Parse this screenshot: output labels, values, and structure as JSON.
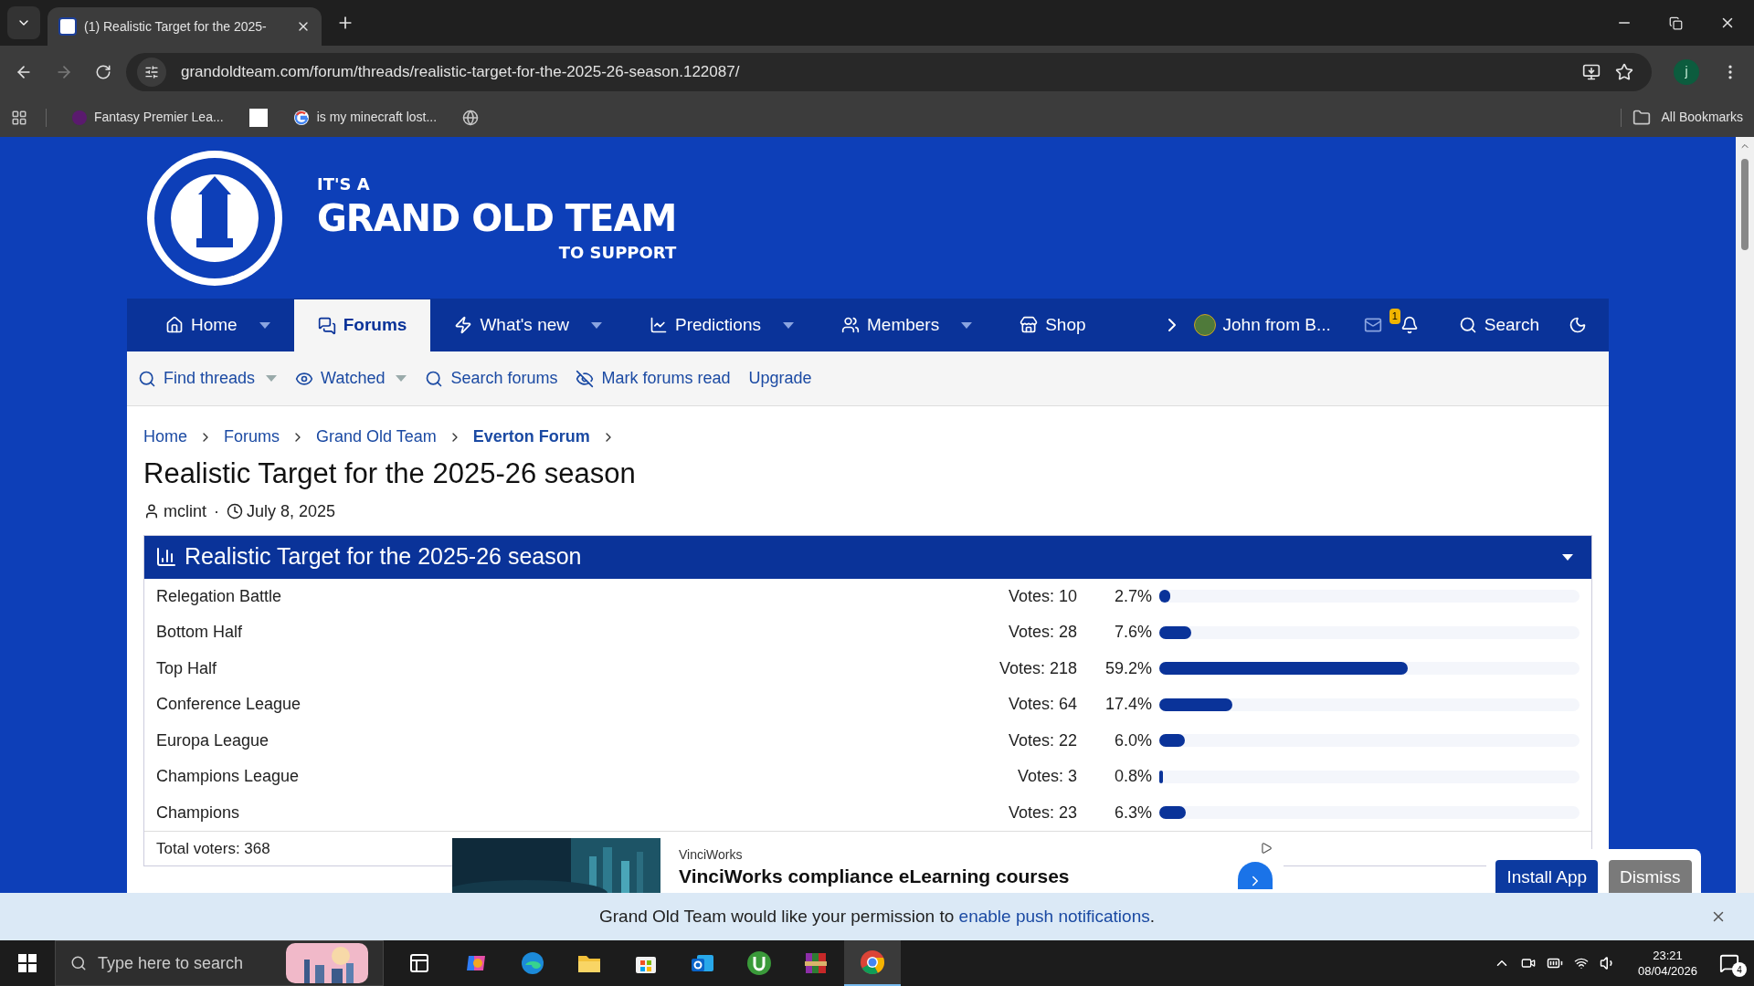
{
  "browser": {
    "tabs": [
      {
        "title": "(1) Realistic Target for the 2025-",
        "selected": true
      }
    ],
    "url": "grandoldteam.com/forum/threads/realistic-target-for-the-2025-26-season.122087/",
    "bookmarks": [
      {
        "kind": "league",
        "label": "Fantasy Premier Lea..."
      },
      {
        "kind": "blank"
      },
      {
        "kind": "google",
        "label": "is my minecraft lost..."
      },
      {
        "kind": "globe"
      }
    ],
    "all_bookmarks": "All Bookmarks",
    "profile_initial": "j"
  },
  "header": {
    "logo_lines": [
      "IT'S A",
      "GRAND OLD TEAM",
      "TO SUPPORT"
    ]
  },
  "nav": {
    "items": [
      {
        "kind": "home",
        "label": "Home",
        "dropdown": true,
        "selected": false
      },
      {
        "kind": "forums",
        "label": "Forums",
        "dropdown": false,
        "selected": true
      },
      {
        "kind": "new",
        "label": "What's new",
        "dropdown": true,
        "selected": false
      },
      {
        "kind": "predictions",
        "label": "Predictions",
        "dropdown": true,
        "selected": false
      },
      {
        "kind": "members",
        "label": "Members",
        "dropdown": true,
        "selected": false
      },
      {
        "kind": "shop",
        "label": "Shop",
        "dropdown": false,
        "selected": false
      }
    ],
    "user": "John from B...",
    "alert_count": "1",
    "search": "Search"
  },
  "subnav": [
    {
      "kind": "find",
      "label": "Find threads",
      "dropdown": true
    },
    {
      "kind": "watched",
      "label": "Watched",
      "dropdown": true
    },
    {
      "kind": "search",
      "label": "Search forums",
      "dropdown": false
    },
    {
      "kind": "mark",
      "label": "Mark forums read",
      "dropdown": false
    },
    {
      "kind": "plain",
      "label": "Upgrade",
      "dropdown": false
    }
  ],
  "breadcrumbs": [
    {
      "label": "Home",
      "current": false
    },
    {
      "label": "Forums",
      "current": false
    },
    {
      "label": "Grand Old Team",
      "current": false
    },
    {
      "label": "Everton Forum",
      "current": true
    }
  ],
  "thread": {
    "title": "Realistic Target for the 2025-26 season",
    "author": "mclint",
    "separator": "·",
    "date": "July 8, 2025"
  },
  "poll": {
    "title": "Realistic Target for the 2025-26 season",
    "expanded": true,
    "options": [
      {
        "label": "Relegation Battle",
        "votes": "Votes: 10",
        "percent": "2.7%",
        "level": 0.027
      },
      {
        "label": "Bottom Half",
        "votes": "Votes: 28",
        "percent": "7.6%",
        "level": 0.076
      },
      {
        "label": "Top Half",
        "votes": "Votes: 218",
        "percent": "59.2%",
        "level": 0.592
      },
      {
        "label": "Conference League",
        "votes": "Votes: 64",
        "percent": "17.4%",
        "level": 0.174
      },
      {
        "label": "Europa League",
        "votes": "Votes: 22",
        "percent": "6.0%",
        "level": 0.06
      },
      {
        "label": "Champions League",
        "votes": "Votes: 3",
        "percent": "0.8%",
        "level": 0.008
      },
      {
        "label": "Champions",
        "votes": "Votes: 23",
        "percent": "6.3%",
        "level": 0.063
      }
    ],
    "total": "Total voters: 368"
  },
  "ad": {
    "sponsor": "VinciWorks",
    "headline": "VinciWorks compliance eLearning courses"
  },
  "install_prompt": {
    "buttons": [
      {
        "kind": "primary",
        "label": "Install App"
      },
      {
        "kind": "secondary",
        "label": "Dismiss"
      }
    ]
  },
  "push_banner": {
    "text": "Grand Old Team would like your permission to",
    "link": "enable push notifications",
    "end": "."
  },
  "taskbar": {
    "search_placeholder": "Type here to search",
    "apps": [
      {
        "kind": "taskview",
        "active": false
      },
      {
        "kind": "copilot",
        "active": false
      },
      {
        "kind": "edge",
        "active": false
      },
      {
        "kind": "explorer",
        "active": false
      },
      {
        "kind": "store",
        "active": false
      },
      {
        "kind": "outlook",
        "active": false
      },
      {
        "kind": "torrent",
        "active": false
      },
      {
        "kind": "archive",
        "active": false
      },
      {
        "kind": "chrome",
        "active": true
      }
    ],
    "time": "23:21",
    "date": "08/04/2026",
    "notifications": "4"
  }
}
